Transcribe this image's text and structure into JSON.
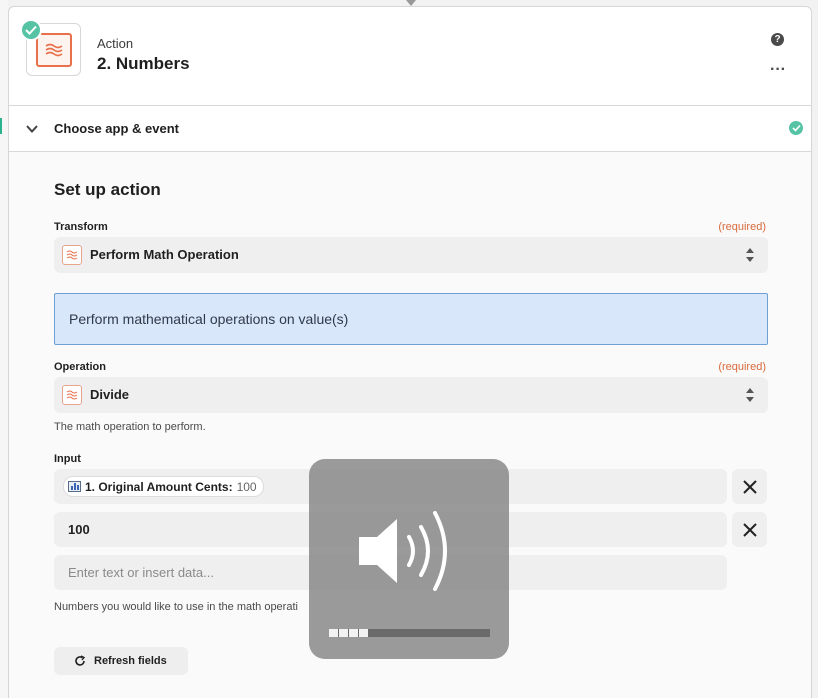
{
  "header": {
    "step_type": "Action",
    "step_title": "2. Numbers"
  },
  "section": {
    "title": "Choose app & event"
  },
  "setup": {
    "title": "Set up action",
    "transform": {
      "label": "Transform",
      "required": "(required)",
      "value": "Perform Math Operation"
    },
    "info_text": "Perform mathematical operations on value(s)",
    "operation": {
      "label": "Operation",
      "required": "(required)",
      "value": "Divide",
      "help": "The math operation to perform."
    },
    "input": {
      "label": "Input",
      "rows": [
        {
          "pill_name": "1. Original Amount Cents:",
          "pill_value": "100"
        },
        {
          "value": "100"
        }
      ],
      "placeholder": "Enter text or insert data...",
      "help": "Numbers you would like to use in the math operati"
    },
    "refresh_label": "Refresh fields"
  },
  "volume_overlay": {
    "level_percent": 25
  },
  "colors": {
    "accent_orange": "#e8704a",
    "success_green": "#56c3a4",
    "required_orange": "#d86a3a",
    "info_bg": "#d9e7fb",
    "info_border": "#6f9fd3"
  }
}
